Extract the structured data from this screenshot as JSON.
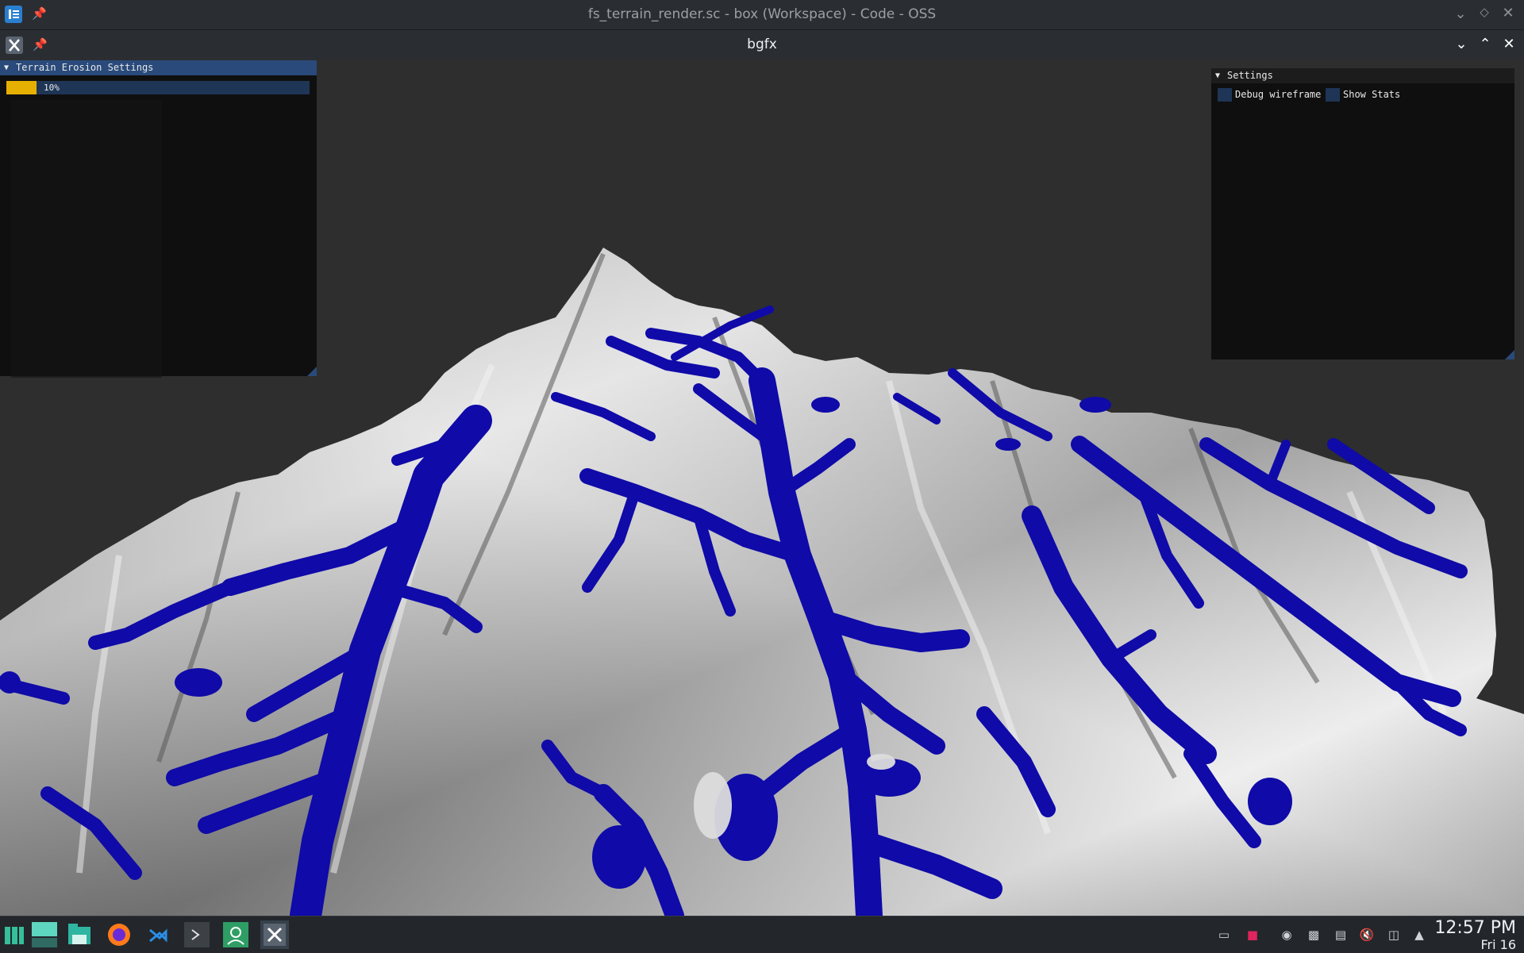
{
  "window": {
    "title": "fs_terrain_render.sc - box (Workspace) - Code - OSS"
  },
  "app": {
    "title": "bgfx"
  },
  "erosion_panel": {
    "title": "Terrain Erosion Settings",
    "progress_label": "10%",
    "progress_fraction": 0.1
  },
  "settings_panel": {
    "title": "Settings",
    "debug_wireframe": {
      "label": "Debug wireframe",
      "checked": false
    },
    "show_stats": {
      "label": "Show Stats",
      "checked": false
    }
  },
  "colors": {
    "titlebar": "#2a2e32",
    "panel_bg": "#0f0f0f",
    "panel_header": "#294a7a",
    "progress_fill": "#e6b000",
    "water": "#0f0aa8",
    "taskbar": "#23272b"
  },
  "taskbar": {
    "launchers": [
      "app-launcher-icon",
      "desktop-icon",
      "file-manager-icon",
      "firefox-icon",
      "vscode-icon",
      "terminal-icon",
      "screenshot-icon",
      "bgfx-icon"
    ],
    "tray": [
      "display-icon",
      "package-icon",
      "notifications-icon",
      "terminal-tray-icon",
      "clipboard-icon",
      "volume-muted-icon",
      "network-icon",
      "tray-expand-icon"
    ],
    "time": "12:57 PM",
    "date": "Fri 16"
  }
}
